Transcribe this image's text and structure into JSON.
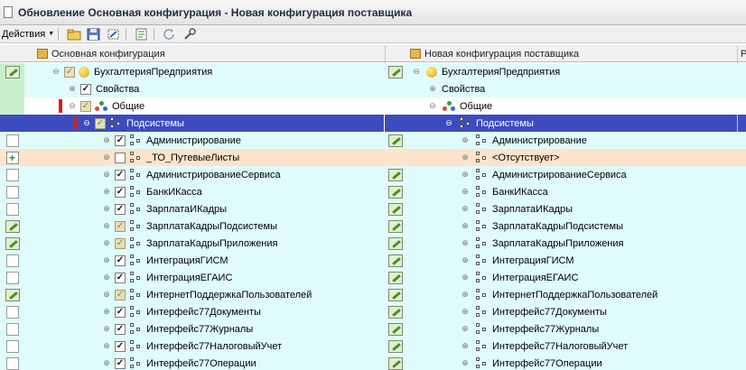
{
  "window": {
    "title": "Обновление Основная конфигурация - Новая конфигурация поставщика"
  },
  "toolbar": {
    "actions_label": "Действия",
    "buttons": [
      "open-icon",
      "save-icon",
      "compare-icon",
      "report-icon",
      "refresh-icon",
      "settings-icon"
    ]
  },
  "columns": {
    "left": "Основная конфигурация",
    "right": "Новая конфигурация поставщика",
    "last": "Р"
  },
  "colors": {
    "row_bg_cyan": "#e0fbfb",
    "row_bg_orange": "#fde3cc",
    "row_bg_white": "#ffffff",
    "selection": "#3c4cbf",
    "mark_green": "#c8f0c8"
  },
  "tree": {
    "root": {
      "left": "БухгалтерияПредприятия",
      "right": "БухгалтерияПредприятия"
    },
    "properties": {
      "left": "Свойства",
      "right": "Свойства"
    },
    "common": {
      "left": "Общие",
      "right": "Общие"
    },
    "subsystems": {
      "left": "Подсистемы",
      "right": "Подсистемы"
    },
    "items": [
      {
        "left": "Администрирование",
        "right": "Администрирование",
        "mark": "empty",
        "check": "on",
        "mid": "edit",
        "bg": "cyan"
      },
      {
        "left": "_ТО_ПутевыеЛисты",
        "right": "<Отсутствует>",
        "mark": "plus",
        "check": "off",
        "mid": "none",
        "bg": "orange"
      },
      {
        "left": "АдминистрированиеСервиса",
        "right": "АдминистрированиеСервиса",
        "mark": "empty",
        "check": "on",
        "mid": "edit",
        "bg": "cyan"
      },
      {
        "left": "БанкИКасса",
        "right": "БанкИКасса",
        "mark": "empty",
        "check": "on",
        "mid": "edit",
        "bg": "cyan"
      },
      {
        "left": "ЗарплатаИКадры",
        "right": "ЗарплатаИКадры",
        "mark": "empty",
        "check": "on",
        "mid": "edit",
        "bg": "cyan"
      },
      {
        "left": "ЗарплатаКадрыПодсистемы",
        "right": "ЗарплатаКадрыПодсистемы",
        "mark": "edit",
        "check": "gray",
        "mid": "edit",
        "bg": "cyan"
      },
      {
        "left": "ЗарплатаКадрыПриложения",
        "right": "ЗарплатаКадрыПриложения",
        "mark": "edit",
        "check": "gray",
        "mid": "edit",
        "bg": "cyan"
      },
      {
        "left": "ИнтеграцияГИСМ",
        "right": "ИнтеграцияГИСМ",
        "mark": "empty",
        "check": "on",
        "mid": "edit",
        "bg": "cyan"
      },
      {
        "left": "ИнтеграцияЕГАИС",
        "right": "ИнтеграцияЕГАИС",
        "mark": "empty",
        "check": "on",
        "mid": "edit",
        "bg": "cyan"
      },
      {
        "left": "ИнтернетПоддержкаПользователей",
        "right": "ИнтернетПоддержкаПользователей",
        "mark": "edit",
        "check": "gray",
        "mid": "edit",
        "bg": "cyan"
      },
      {
        "left": "Интерфейс77Документы",
        "right": "Интерфейс77Документы",
        "mark": "empty",
        "check": "on",
        "mid": "edit",
        "bg": "cyan"
      },
      {
        "left": "Интерфейс77Журналы",
        "right": "Интерфейс77Журналы",
        "mark": "empty",
        "check": "on",
        "mid": "edit",
        "bg": "cyan"
      },
      {
        "left": "Интерфейс77НалоговыйУчет",
        "right": "Интерфейс77НалоговыйУчет",
        "mark": "empty",
        "check": "on",
        "mid": "edit",
        "bg": "cyan"
      },
      {
        "left": "Интерфейс77Операции",
        "right": "Интерфейс77Операции",
        "mark": "empty",
        "check": "on",
        "mid": "edit",
        "bg": "cyan"
      }
    ]
  }
}
